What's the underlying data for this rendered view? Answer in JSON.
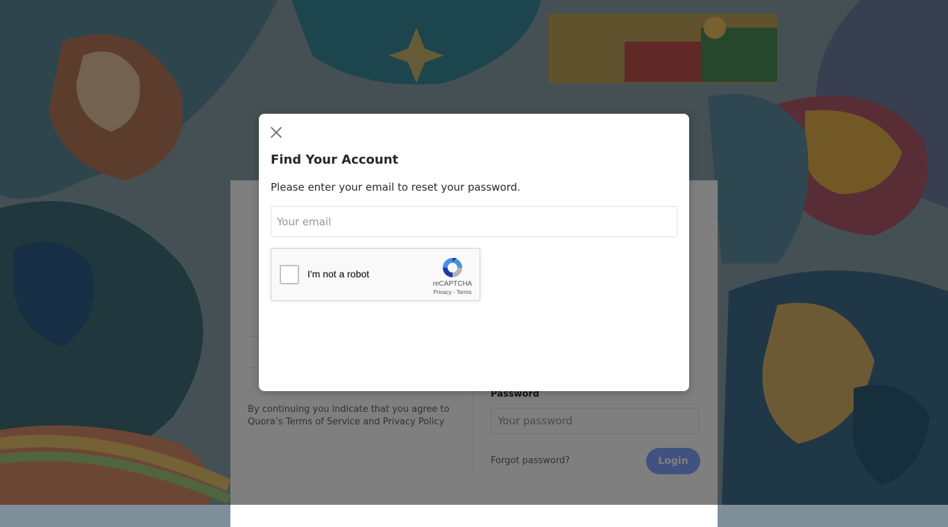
{
  "background": {
    "terms_text_prefix": "By continuing you indicate that you agree to Quora’s",
    "terms_link": "Terms of Service",
    "terms_and": "and",
    "privacy_link": "Privacy Policy",
    "password_label": "Password",
    "password_placeholder": "Your password",
    "forgot_password": "Forgot password?",
    "login_button": "Login"
  },
  "modal": {
    "title": "Find Your Account",
    "subtitle": "Please enter your email to reset your password.",
    "email_placeholder": "Your email",
    "email_value": "",
    "close_icon": "close-icon"
  },
  "recaptcha": {
    "label": "I'm not a robot",
    "brand": "reCAPTCHA",
    "privacy": "Privacy",
    "separator": "-",
    "terms": "Terms",
    "checked": false
  },
  "colors": {
    "overlay": "rgba(0,0,0,0.5)",
    "modal_bg": "#ffffff",
    "recaptcha_blue": "#4a90e2",
    "login_blue": "#2e69ff"
  }
}
